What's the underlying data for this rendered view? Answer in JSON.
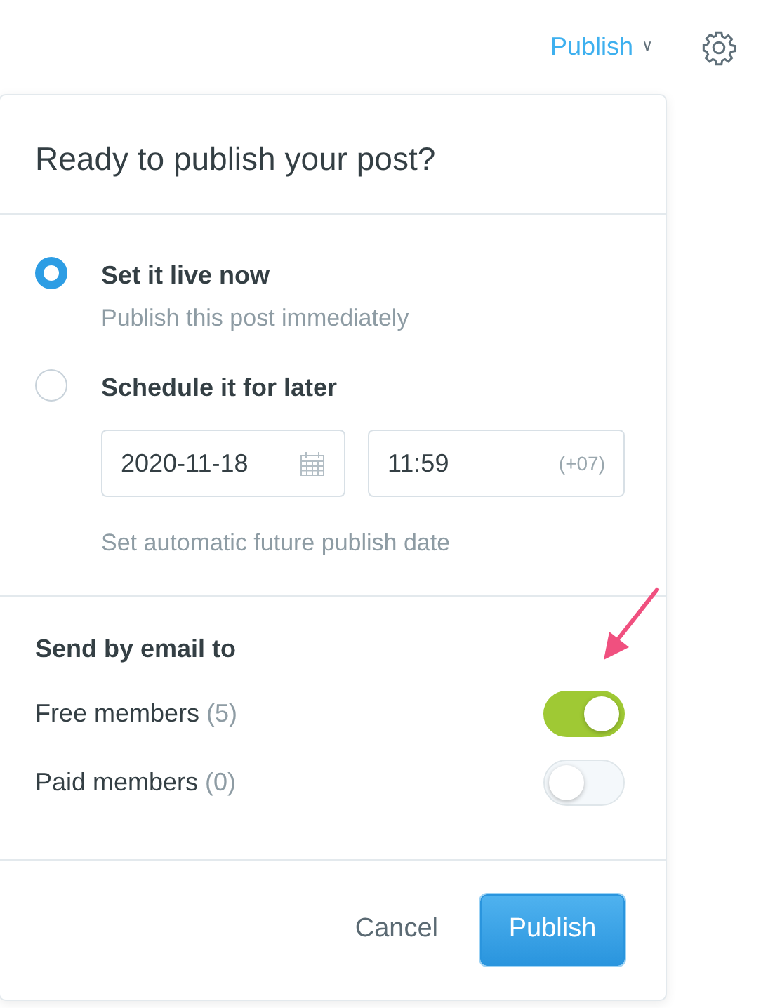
{
  "topbar": {
    "publish_menu": "Publish",
    "publish_caret": "∨"
  },
  "dialog": {
    "title": "Ready to publish your post?",
    "options": [
      {
        "label": "Set it live now",
        "hint": "Publish this post immediately",
        "selected": true
      },
      {
        "label": "Schedule it for later",
        "selected": false,
        "date": "2020-11-18",
        "time": "11:59",
        "timezone": "(+07)",
        "hint": "Set automatic future publish date"
      }
    ],
    "email": {
      "heading": "Send by email to",
      "recipients": [
        {
          "label": "Free members",
          "count": "(5)",
          "on": true
        },
        {
          "label": "Paid members",
          "count": "(0)",
          "on": false
        }
      ]
    },
    "buttons": {
      "cancel": "Cancel",
      "publish": "Publish"
    }
  }
}
